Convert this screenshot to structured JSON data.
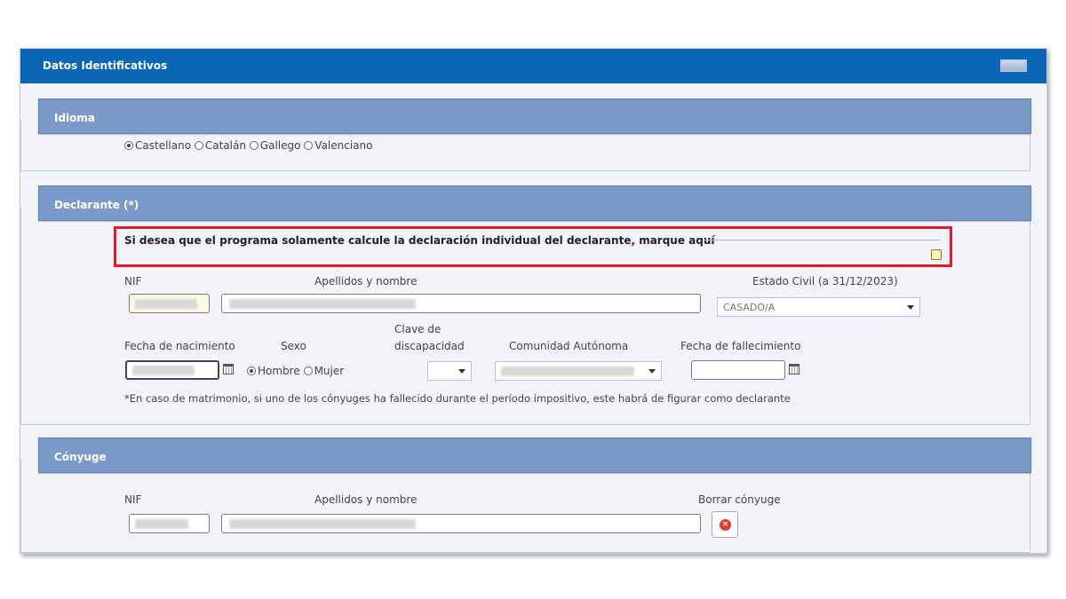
{
  "panel": {
    "title": "Datos Identificativos"
  },
  "idioma": {
    "title": "Idioma",
    "options": [
      {
        "label": "Castellano",
        "selected": true
      },
      {
        "label": "Catalán",
        "selected": false
      },
      {
        "label": "Gallego",
        "selected": false
      },
      {
        "label": "Valenciano",
        "selected": false
      }
    ]
  },
  "declarante": {
    "title": "Declarante (*)",
    "individual_label": "Si desea que el programa solamente calcule la declaración individual del declarante, marque aquí",
    "nif_label": "NIF",
    "name_label": "Apellidos y nombre",
    "estado_civil_label": "Estado Civil (a 31/12/2023)",
    "estado_civil_value": "CASADO/A",
    "fecha_nac_label": "Fecha de nacimiento",
    "sexo_label": "Sexo",
    "sexo_options": [
      {
        "label": "Hombre",
        "selected": true
      },
      {
        "label": "Mujer",
        "selected": false
      }
    ],
    "clave_label_1": "Clave de",
    "clave_label_2": "discapacidad",
    "comunidad_label": "Comunidad Autónoma",
    "fecha_fall_label": "Fecha de fallecimiento",
    "note": "*En caso de matrimonio, si uno de los cónyuges ha fallecido durante el período impositivo, este habrá de figurar como declarante"
  },
  "conyuge": {
    "title": "Cónyuge",
    "nif_label": "NIF",
    "name_label": "Apellidos y nombre",
    "borrar_label": "Borrar cónyuge"
  },
  "colors": {
    "header": "#0b67b5",
    "section": "#7b9ac9",
    "highlight": "#e4182a"
  }
}
